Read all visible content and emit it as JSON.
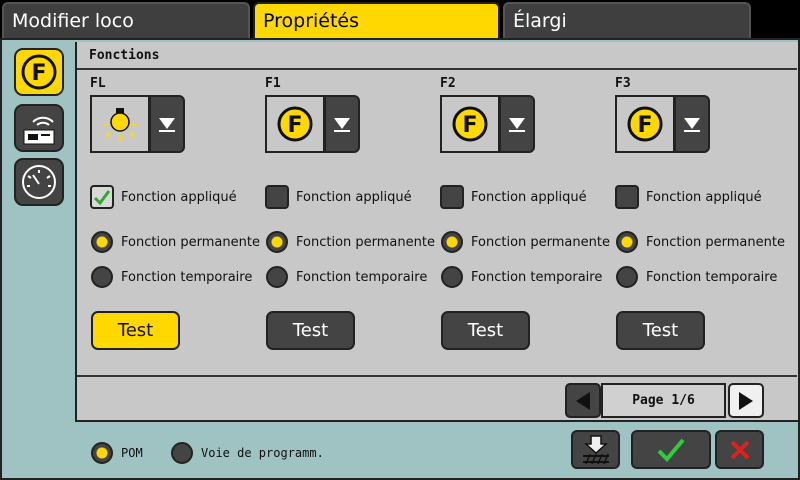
{
  "tabs": [
    {
      "label": "Modifier loco",
      "active": false
    },
    {
      "label": "Propriétés",
      "active": true
    },
    {
      "label": "Élargi",
      "active": false
    }
  ],
  "section_title": "Fonctions",
  "functions": [
    {
      "name": "FL",
      "icon": "lightbulb-icon",
      "applied": true,
      "mode": "permanent"
    },
    {
      "name": "F1",
      "icon": "function-f-icon",
      "applied": false,
      "mode": "permanent"
    },
    {
      "name": "F2",
      "icon": "function-f-icon",
      "applied": false,
      "mode": "permanent"
    },
    {
      "name": "F3",
      "icon": "function-f-icon",
      "applied": false,
      "mode": "permanent"
    }
  ],
  "labels": {
    "applied": "Fonction appliqué",
    "permanent": "Fonction permanente",
    "temporary": "Fonction temporaire",
    "test": "Test"
  },
  "pager": {
    "text": "Page 1/6"
  },
  "bottom": {
    "pom_label": "POM",
    "track_label": "Voie de programm.",
    "selected": "POM"
  },
  "colors": {
    "accent": "#ffd800",
    "panel": "#9fc2c2",
    "content": "#c8c8c8",
    "button": "#444444",
    "ok": "#2ecc40",
    "cancel": "#e02020"
  }
}
